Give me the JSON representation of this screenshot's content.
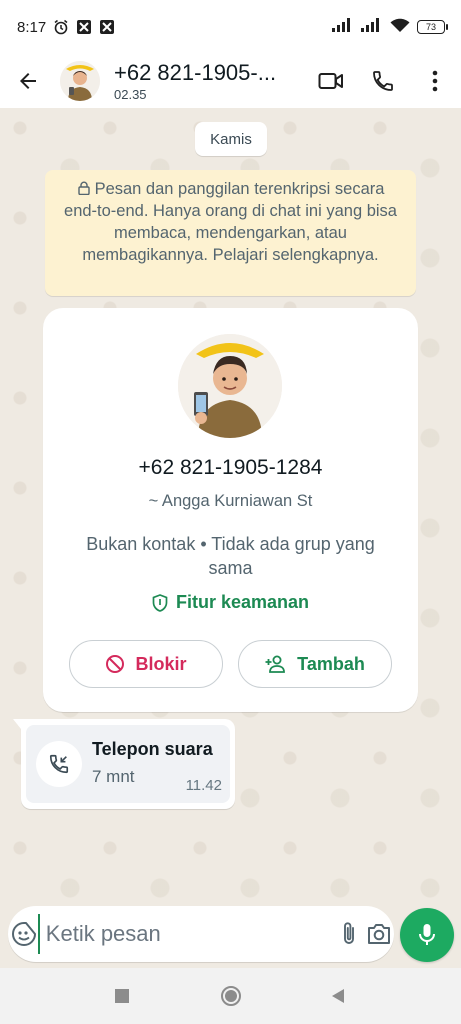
{
  "status_bar": {
    "time": "8:17",
    "battery": "73"
  },
  "header": {
    "title": "+62 821-1905-...",
    "subtitle": "02.35"
  },
  "chat": {
    "date_chip": "Kamis",
    "encryption_notice": "Pesan dan panggilan terenkripsi secara end-to-end. Hanya orang di chat ini yang bisa membaca, mendengarkan, atau membagikannya. Pelajari selengkapnya.",
    "contact_card": {
      "phone": "+62 821-1905-1284",
      "name": "~ Angga Kurniawan St",
      "note": "Bukan kontak • Tidak ada grup yang sama",
      "security_label": "Fitur keamanan",
      "block_label": "Blokir",
      "add_label": "Tambah"
    },
    "call_bubble": {
      "title": "Telepon suara",
      "duration": "7 mnt",
      "time": "11.42"
    }
  },
  "composer": {
    "placeholder": "Ketik pesan"
  },
  "colors": {
    "accent_green": "#1d8a53",
    "mic_button": "#1daa61",
    "block_red": "#d42a5c",
    "notice_bg": "#fdf2d1",
    "chat_bg": "#efeae2"
  },
  "icons": {
    "status": [
      "alarm-icon",
      "app-notification-icon",
      "app-notification-icon",
      "signal-icon",
      "signal-icon",
      "wifi-icon",
      "battery-icon"
    ],
    "header": [
      "back-arrow-icon",
      "video-call-icon",
      "phone-icon",
      "more-vert-icon"
    ],
    "composer": [
      "sticker-icon",
      "attach-icon",
      "camera-icon",
      "mic-icon"
    ],
    "nav": [
      "recents-square-icon",
      "home-circle-icon",
      "back-triangle-icon"
    ]
  }
}
